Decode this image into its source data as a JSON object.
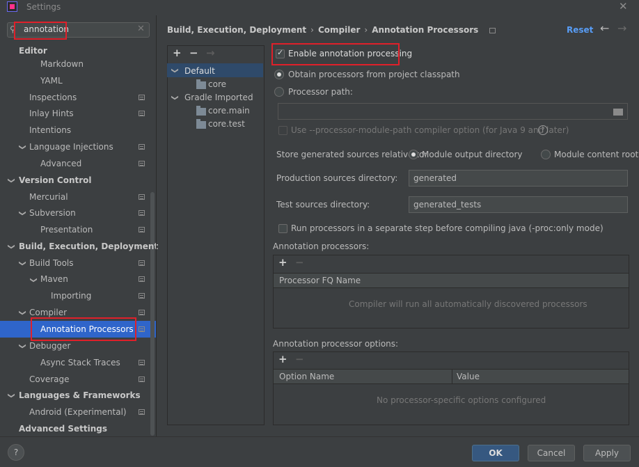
{
  "window": {
    "title": "Settings"
  },
  "search": {
    "value": "annotation"
  },
  "tree": {
    "editor": "Editor",
    "markdown": "Markdown",
    "yaml": "YAML",
    "inspections": "Inspections",
    "inlay_hints": "Inlay Hints",
    "intentions": "Intentions",
    "language_injections": "Language Injections",
    "advanced": "Advanced",
    "version_control": "Version Control",
    "mercurial": "Mercurial",
    "subversion": "Subversion",
    "presentation": "Presentation",
    "build_execution_deployment": "Build, Execution, Deployment",
    "build_tools": "Build Tools",
    "maven": "Maven",
    "importing": "Importing",
    "compiler": "Compiler",
    "annotation_processors": "Annotation Processors",
    "debugger": "Debugger",
    "async_stack_traces": "Async Stack Traces",
    "coverage": "Coverage",
    "languages_frameworks": "Languages & Frameworks",
    "android": "Android (Experimental)",
    "advanced_settings": "Advanced Settings"
  },
  "breadcrumb": {
    "part1": "Build, Execution, Deployment",
    "part2": "Compiler",
    "part3": "Annotation Processors"
  },
  "header": {
    "reset": "Reset"
  },
  "profiles": {
    "default": "Default",
    "core": "core",
    "gradle_imported": "Gradle Imported",
    "core_main": "core.main",
    "core_test": "core.test"
  },
  "options": {
    "enable": "Enable annotation processing",
    "obtain_classpath": "Obtain processors from project classpath",
    "processor_path": "Processor path:",
    "module_path": "Use --processor-module-path compiler option (for Java 9 and later)",
    "store_relative": "Store generated sources relative to:",
    "module_output": "Module output directory",
    "module_content": "Module content root",
    "production_dir_label": "Production sources directory:",
    "production_dir_value": "generated",
    "test_dir_label": "Test sources directory:",
    "test_dir_value": "generated_tests",
    "run_separate": "Run processors in a separate step before compiling java (-proc:only mode)"
  },
  "processors_table": {
    "section_label": "Annotation processors:",
    "column": "Processor FQ Name",
    "empty": "Compiler will run all automatically discovered processors"
  },
  "options_table": {
    "section_label": "Annotation processor options:",
    "col_name": "Option Name",
    "col_value": "Value",
    "empty": "No processor-specific options configured"
  },
  "buttons": {
    "help": "?",
    "ok": "OK",
    "cancel": "Cancel",
    "apply": "Apply"
  },
  "icons": {
    "add": "+",
    "remove": "−",
    "arrow_right": "→",
    "back": "←",
    "forward": "→",
    "close": "✕"
  }
}
